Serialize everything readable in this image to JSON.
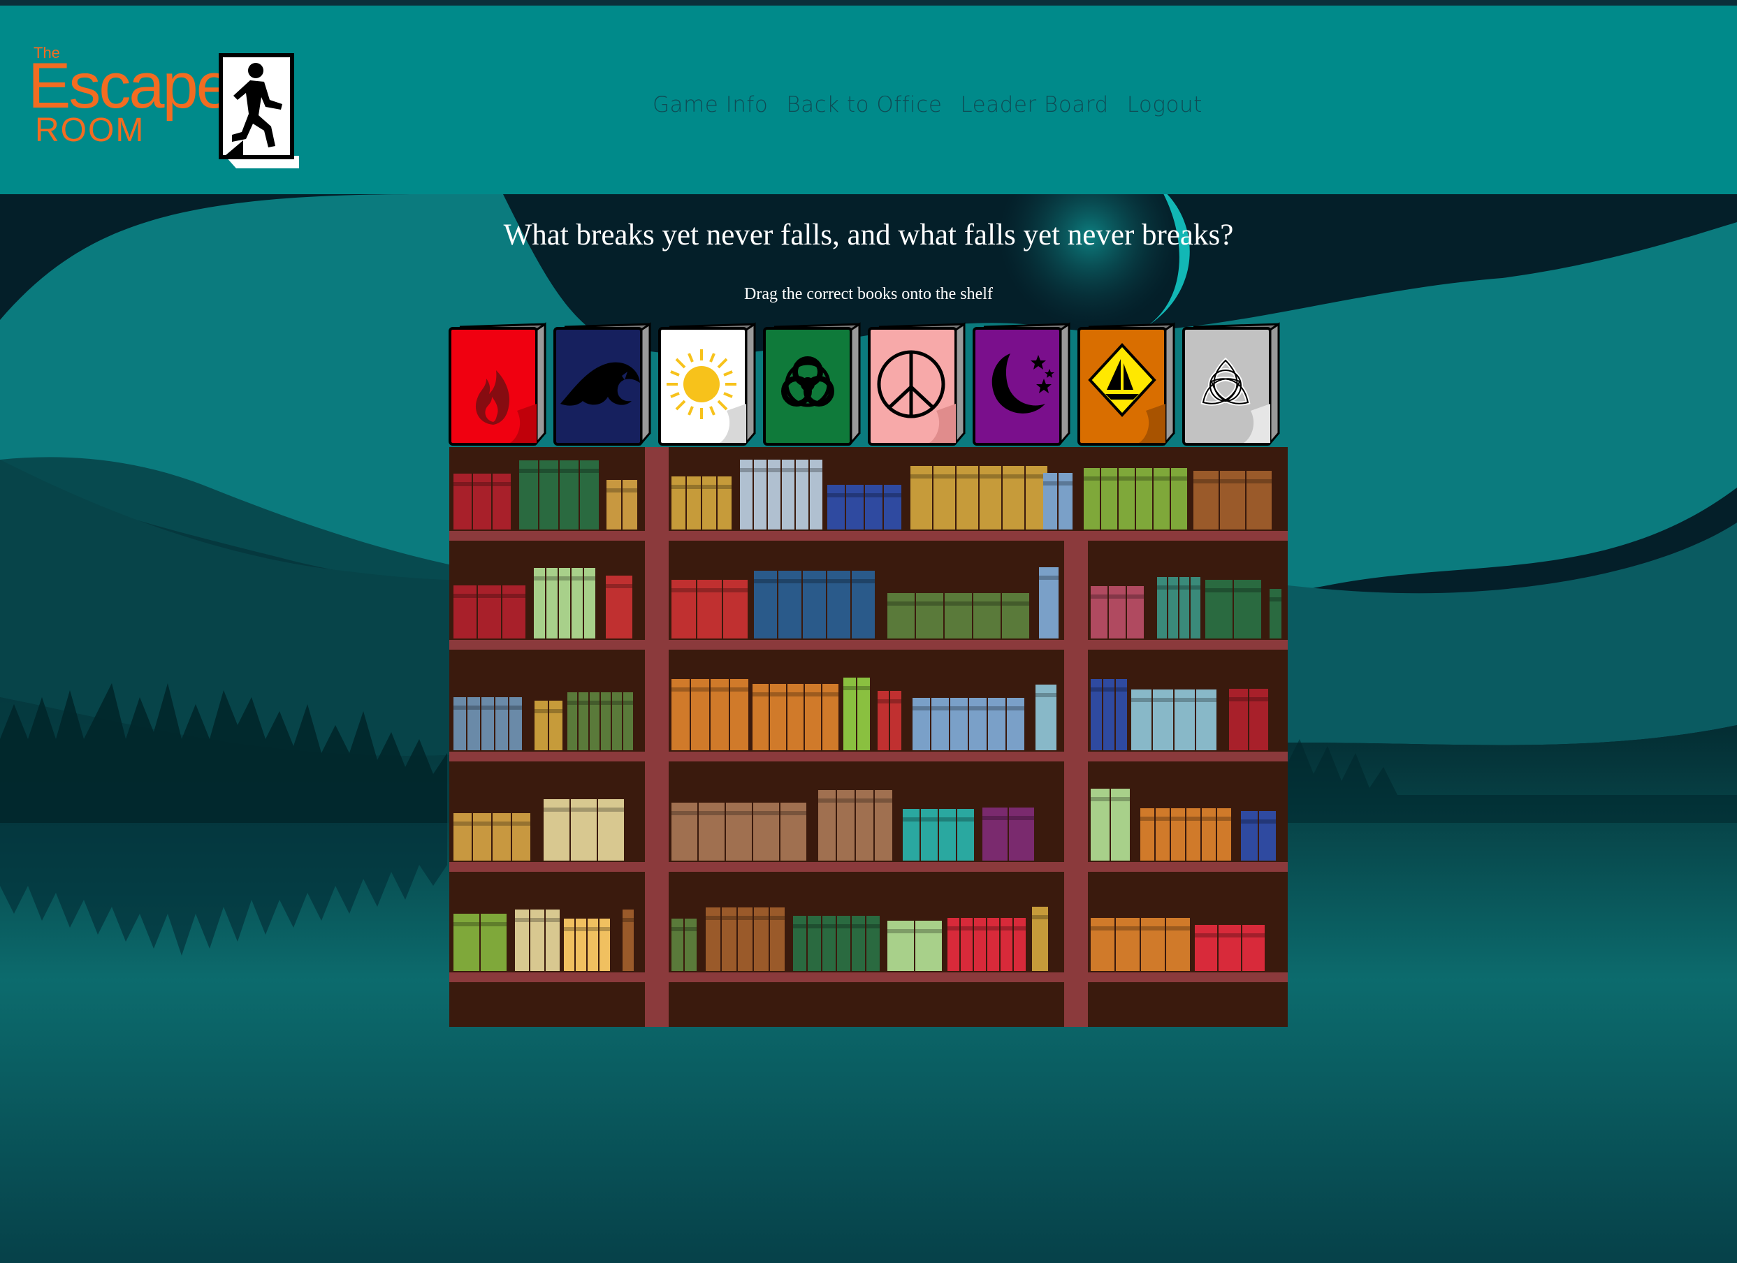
{
  "header": {
    "logo": {
      "line1": "The",
      "line2": "Escape",
      "line3": "ROOM"
    },
    "nav": [
      {
        "label": "Game Info"
      },
      {
        "label": "Back to Office"
      },
      {
        "label": "Leader Board"
      },
      {
        "label": "Logout"
      }
    ]
  },
  "puzzle": {
    "question": "What breaks yet never falls, and what falls yet never breaks?",
    "instruction": "Drag the correct books onto the shelf"
  },
  "books": [
    {
      "name": "fire",
      "color": "#f00010",
      "icon": "fire-icon"
    },
    {
      "name": "wave",
      "color": "#16205e",
      "icon": "wave-icon"
    },
    {
      "name": "sun",
      "color": "#ffffff",
      "icon": "sun-icon"
    },
    {
      "name": "biohazard",
      "color": "#0f7a3a",
      "icon": "biohazard-icon"
    },
    {
      "name": "peace",
      "color": "#f7a9a9",
      "icon": "peace-icon"
    },
    {
      "name": "night",
      "color": "#7a0f8c",
      "icon": "moon-stars-icon"
    },
    {
      "name": "sailboat",
      "color": "#d96e00",
      "icon": "sailboat-sign-icon"
    },
    {
      "name": "triquetra",
      "color": "#c2c2c2",
      "icon": "triquetra-icon"
    }
  ]
}
